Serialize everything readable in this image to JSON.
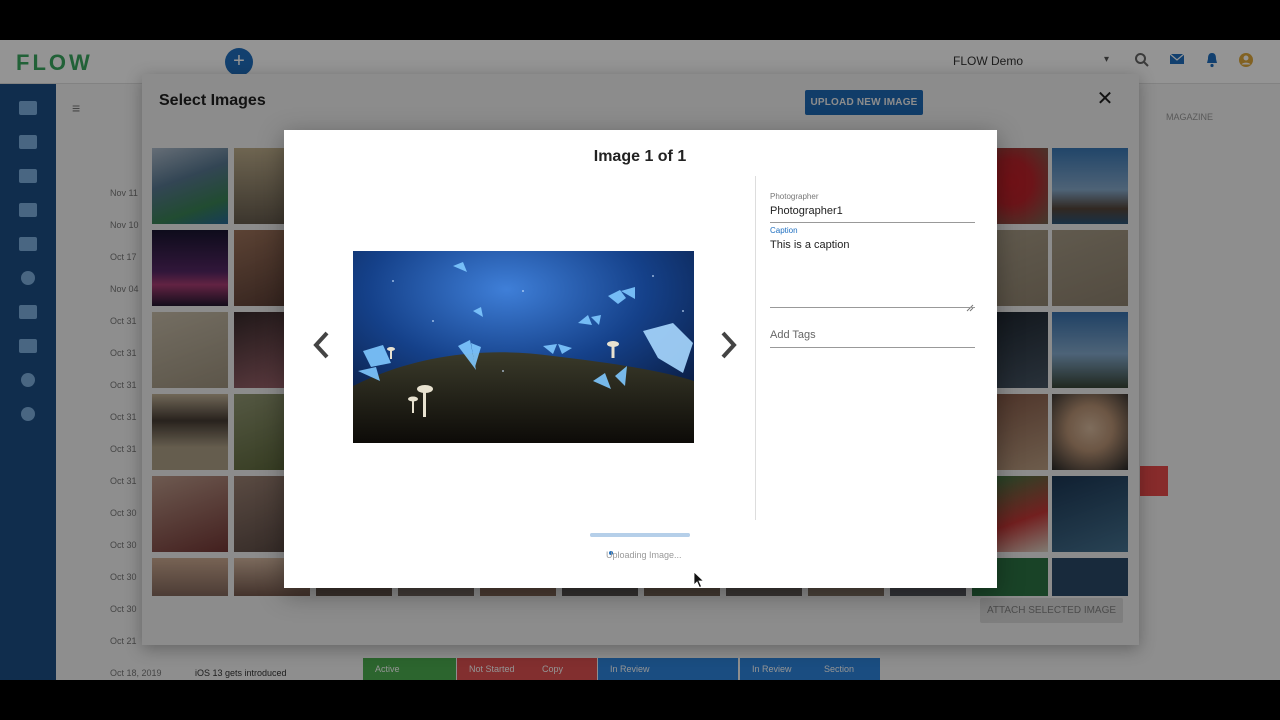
{
  "app": {
    "logo": "FLOW",
    "workspace": "FLOW Demo",
    "fab_label": "+",
    "magazine_label": "MAGAZINE"
  },
  "background_list": {
    "dates": [
      "Nov 11",
      "Nov 10",
      "Oct 17",
      "Nov 04",
      "Oct 31",
      "Oct 31",
      "Oct 31",
      "Oct 31",
      "Oct 31",
      "Oct 31",
      "Oct 30",
      "Oct 30",
      "Oct 30",
      "Oct 30",
      "Oct 21",
      "Oct 18, 2019"
    ],
    "last_row_title": "iOS 13 gets introduced",
    "statuses": [
      "Active",
      "Not Started",
      "Copy Editing",
      "In Review",
      "In Review",
      "Section Editor"
    ]
  },
  "select_modal": {
    "title": "Select Images",
    "upload_button": "UPLOAD NEW IMAGE",
    "close_label": "✕",
    "attach_button": "ATTACH SELECTED IMAGE",
    "thumb_colors": [
      [
        "#4f7aa8",
        "#a89a82"
      ],
      [
        "#2e2346",
        "#9b7868"
      ],
      [
        "#b8ad96",
        "#4b3b3d"
      ],
      [
        "#7b6e5c",
        "#6f7a4e"
      ],
      [
        "#7c4a45",
        "#8a6a5a"
      ],
      [
        "#d9b59a",
        "#8c6e62"
      ]
    ],
    "thumb_colors_right": [
      [
        "#c5262e",
        "#3b6ea6"
      ],
      [
        "#a69a86",
        "#a49985"
      ],
      [
        "#33404e",
        "#3d6b9b"
      ],
      [
        "#7c5a4e",
        "#d6c4ad"
      ],
      [
        "#2c7a48",
        "#1f4a6b"
      ],
      [
        "#3d6b5a",
        "#2d4d6e"
      ]
    ]
  },
  "detail": {
    "title": "Image 1 of 1",
    "photographer_label": "Photographer",
    "photographer_value": "Photographer1",
    "caption_label": "Caption",
    "caption_value": "This is a caption",
    "tags_placeholder": "Add Tags",
    "uploading_text": "Uploading Image...",
    "progress": 1.0
  }
}
